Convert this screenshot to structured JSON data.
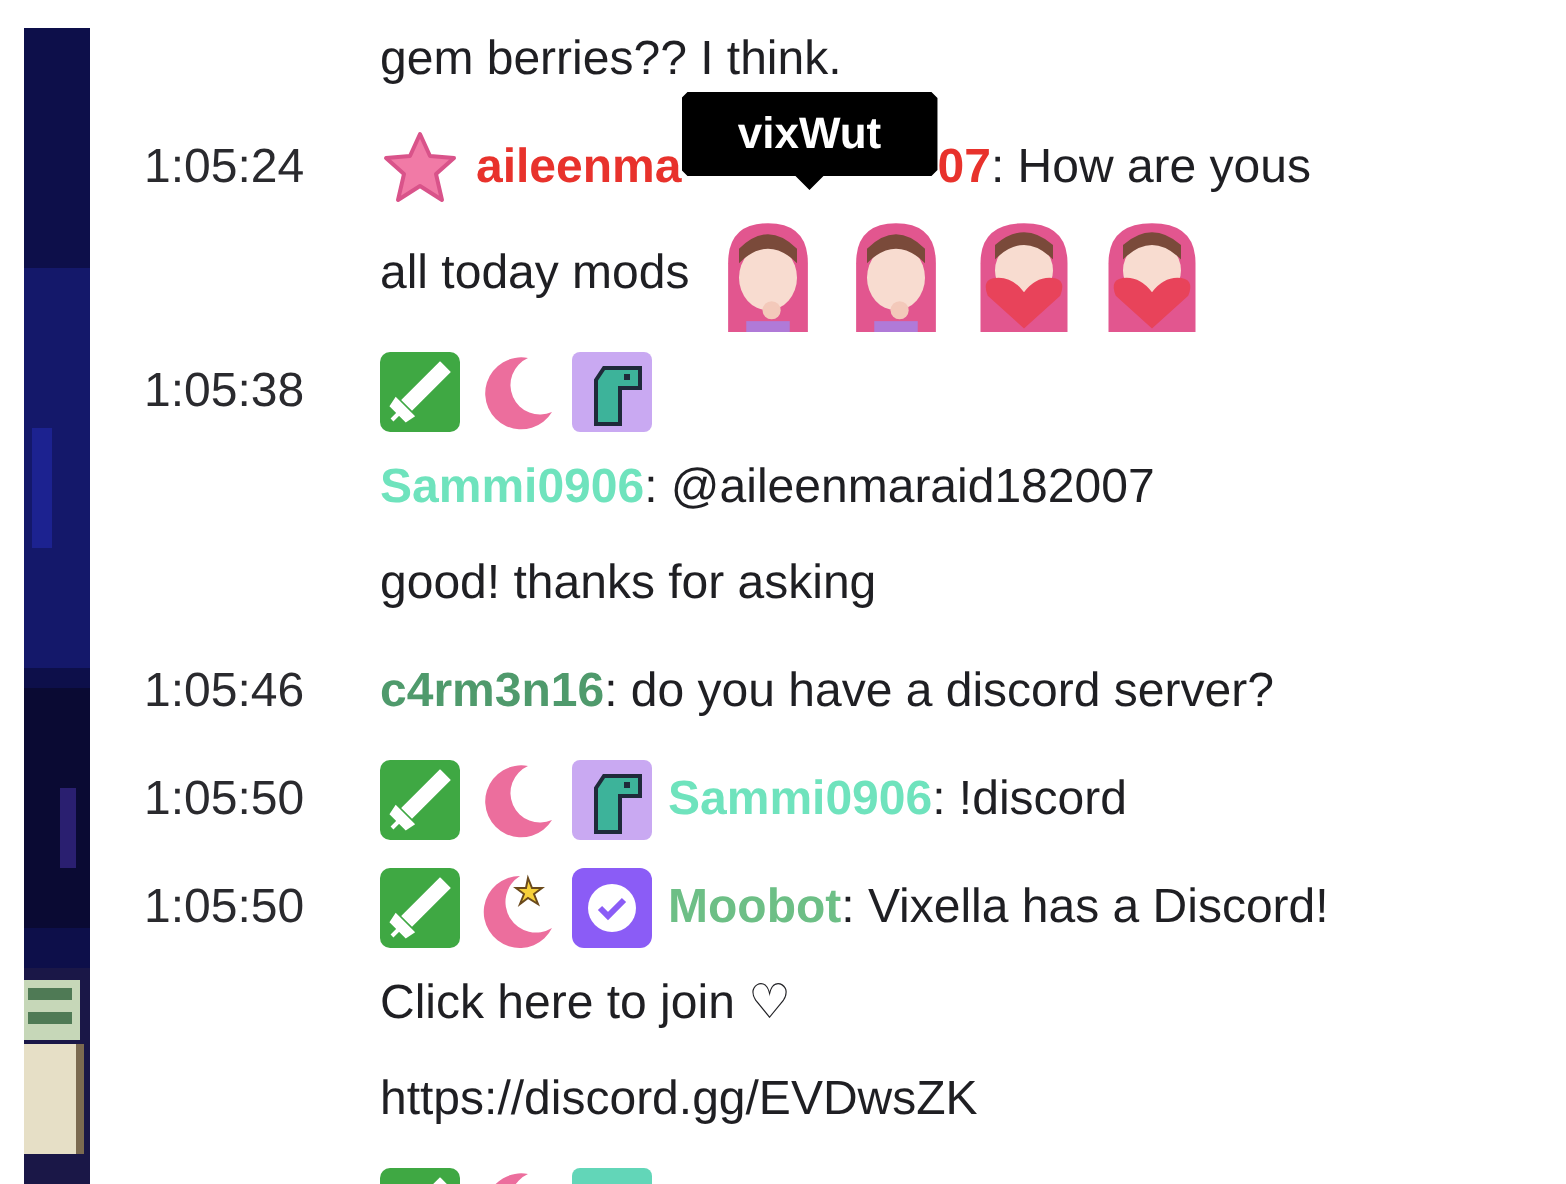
{
  "messages": [
    {
      "lines": [
        [
          {
            "kind": "text",
            "text": "gem berries?? I think."
          }
        ]
      ]
    },
    {
      "time": "1:05:24",
      "lines": [
        [
          {
            "kind": "star-badge"
          },
          {
            "kind": "user",
            "text": "aileenma",
            "color": "#e8322c"
          },
          {
            "kind": "covered",
            "tooltip": "vixWut"
          },
          {
            "kind": "user",
            "text": "07",
            "color": "#e8322c"
          },
          {
            "kind": "text",
            "text": ": How are yous"
          }
        ],
        [
          {
            "kind": "text",
            "text": "all today mods"
          },
          {
            "kind": "question-emote"
          },
          {
            "kind": "question-emote"
          },
          {
            "kind": "heart-emote"
          },
          {
            "kind": "heart-emote"
          }
        ]
      ]
    },
    {
      "time": "1:05:38",
      "lines": [
        [
          {
            "kind": "sword-badge"
          },
          {
            "kind": "moon-badge"
          },
          {
            "kind": "dino-badge"
          }
        ],
        [
          {
            "kind": "user",
            "text": "Sammi0906",
            "color": "#6fe3bd"
          },
          {
            "kind": "text",
            "text": ": @aileenmaraid182007"
          }
        ],
        [
          {
            "kind": "text",
            "text": "good! thanks for asking"
          }
        ]
      ]
    },
    {
      "time": "1:05:46",
      "lines": [
        [
          {
            "kind": "user",
            "text": "c4rm3n16",
            "color": "#4f9a6c"
          },
          {
            "kind": "text",
            "text": ": do you have a discord server?"
          }
        ]
      ]
    },
    {
      "time": "1:05:50",
      "lines": [
        [
          {
            "kind": "sword-badge"
          },
          {
            "kind": "moon-badge"
          },
          {
            "kind": "dino-badge"
          },
          {
            "kind": "user",
            "text": "Sammi0906",
            "color": "#6fe3bd"
          },
          {
            "kind": "text",
            "text": ": !discord"
          }
        ]
      ]
    },
    {
      "time": "1:05:50",
      "lines": [
        [
          {
            "kind": "sword-badge"
          },
          {
            "kind": "moonstar-badge"
          },
          {
            "kind": "verified-badge"
          },
          {
            "kind": "user",
            "text": "Moobot",
            "color": "#6dbf86"
          },
          {
            "kind": "text",
            "text": ": Vixella has a Discord!"
          }
        ],
        [
          {
            "kind": "text",
            "text": "Click here to join ♡"
          }
        ],
        [
          {
            "kind": "text",
            "text": "https://discord.gg/EVDwsZK"
          }
        ]
      ]
    },
    {
      "lines": [
        [
          {
            "kind": "sword-badge"
          },
          {
            "kind": "moon-badge"
          },
          {
            "kind": "teal-badge"
          }
        ]
      ]
    }
  ]
}
